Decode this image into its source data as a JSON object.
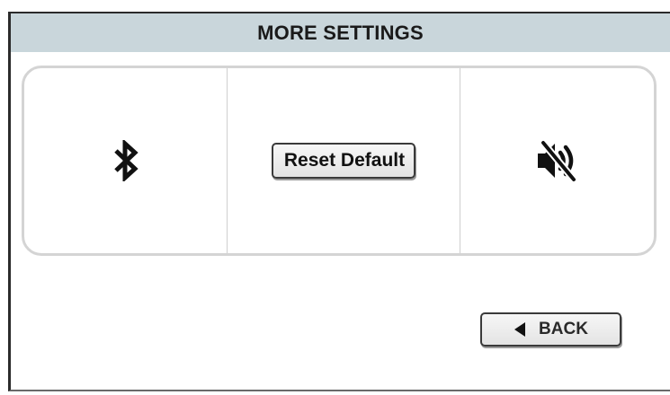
{
  "header": {
    "title": "MORE SETTINGS"
  },
  "panel": {
    "bluetooth": {
      "icon": "bluetooth-icon"
    },
    "reset": {
      "label": "Reset Default"
    },
    "sound": {
      "icon": "speaker-muted-icon"
    }
  },
  "footer": {
    "back_label": "BACK",
    "back_icon": "triangle-left-icon"
  },
  "colors": {
    "title_bar": "#c9d6db",
    "panel_border": "#d4d4d4",
    "button_border": "#3a3a3a"
  }
}
